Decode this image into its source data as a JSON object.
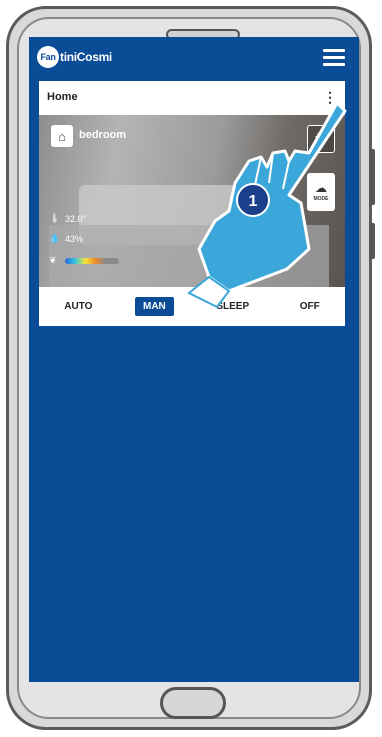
{
  "header": {
    "logo_mark": "Fan",
    "logo_text": "tiniCosmi",
    "menu_icon": "hamburger-menu-icon"
  },
  "card": {
    "title": "Home",
    "room": {
      "name": "bedroom",
      "icon": "thermostat-icon"
    },
    "temperature": "32.0°",
    "humidity": "43%",
    "settings_icon": "gear-icon",
    "mode_button_label": "MODE"
  },
  "modes": [
    {
      "label": "AUTO",
      "active": false
    },
    {
      "label": "MAN",
      "active": true
    },
    {
      "label": "SLEEP",
      "active": false
    },
    {
      "label": "OFF",
      "active": false
    }
  ],
  "instruction_step": "1",
  "colors": {
    "brand_blue": "#0a4c96",
    "hand_blue": "#3aa6d9"
  }
}
